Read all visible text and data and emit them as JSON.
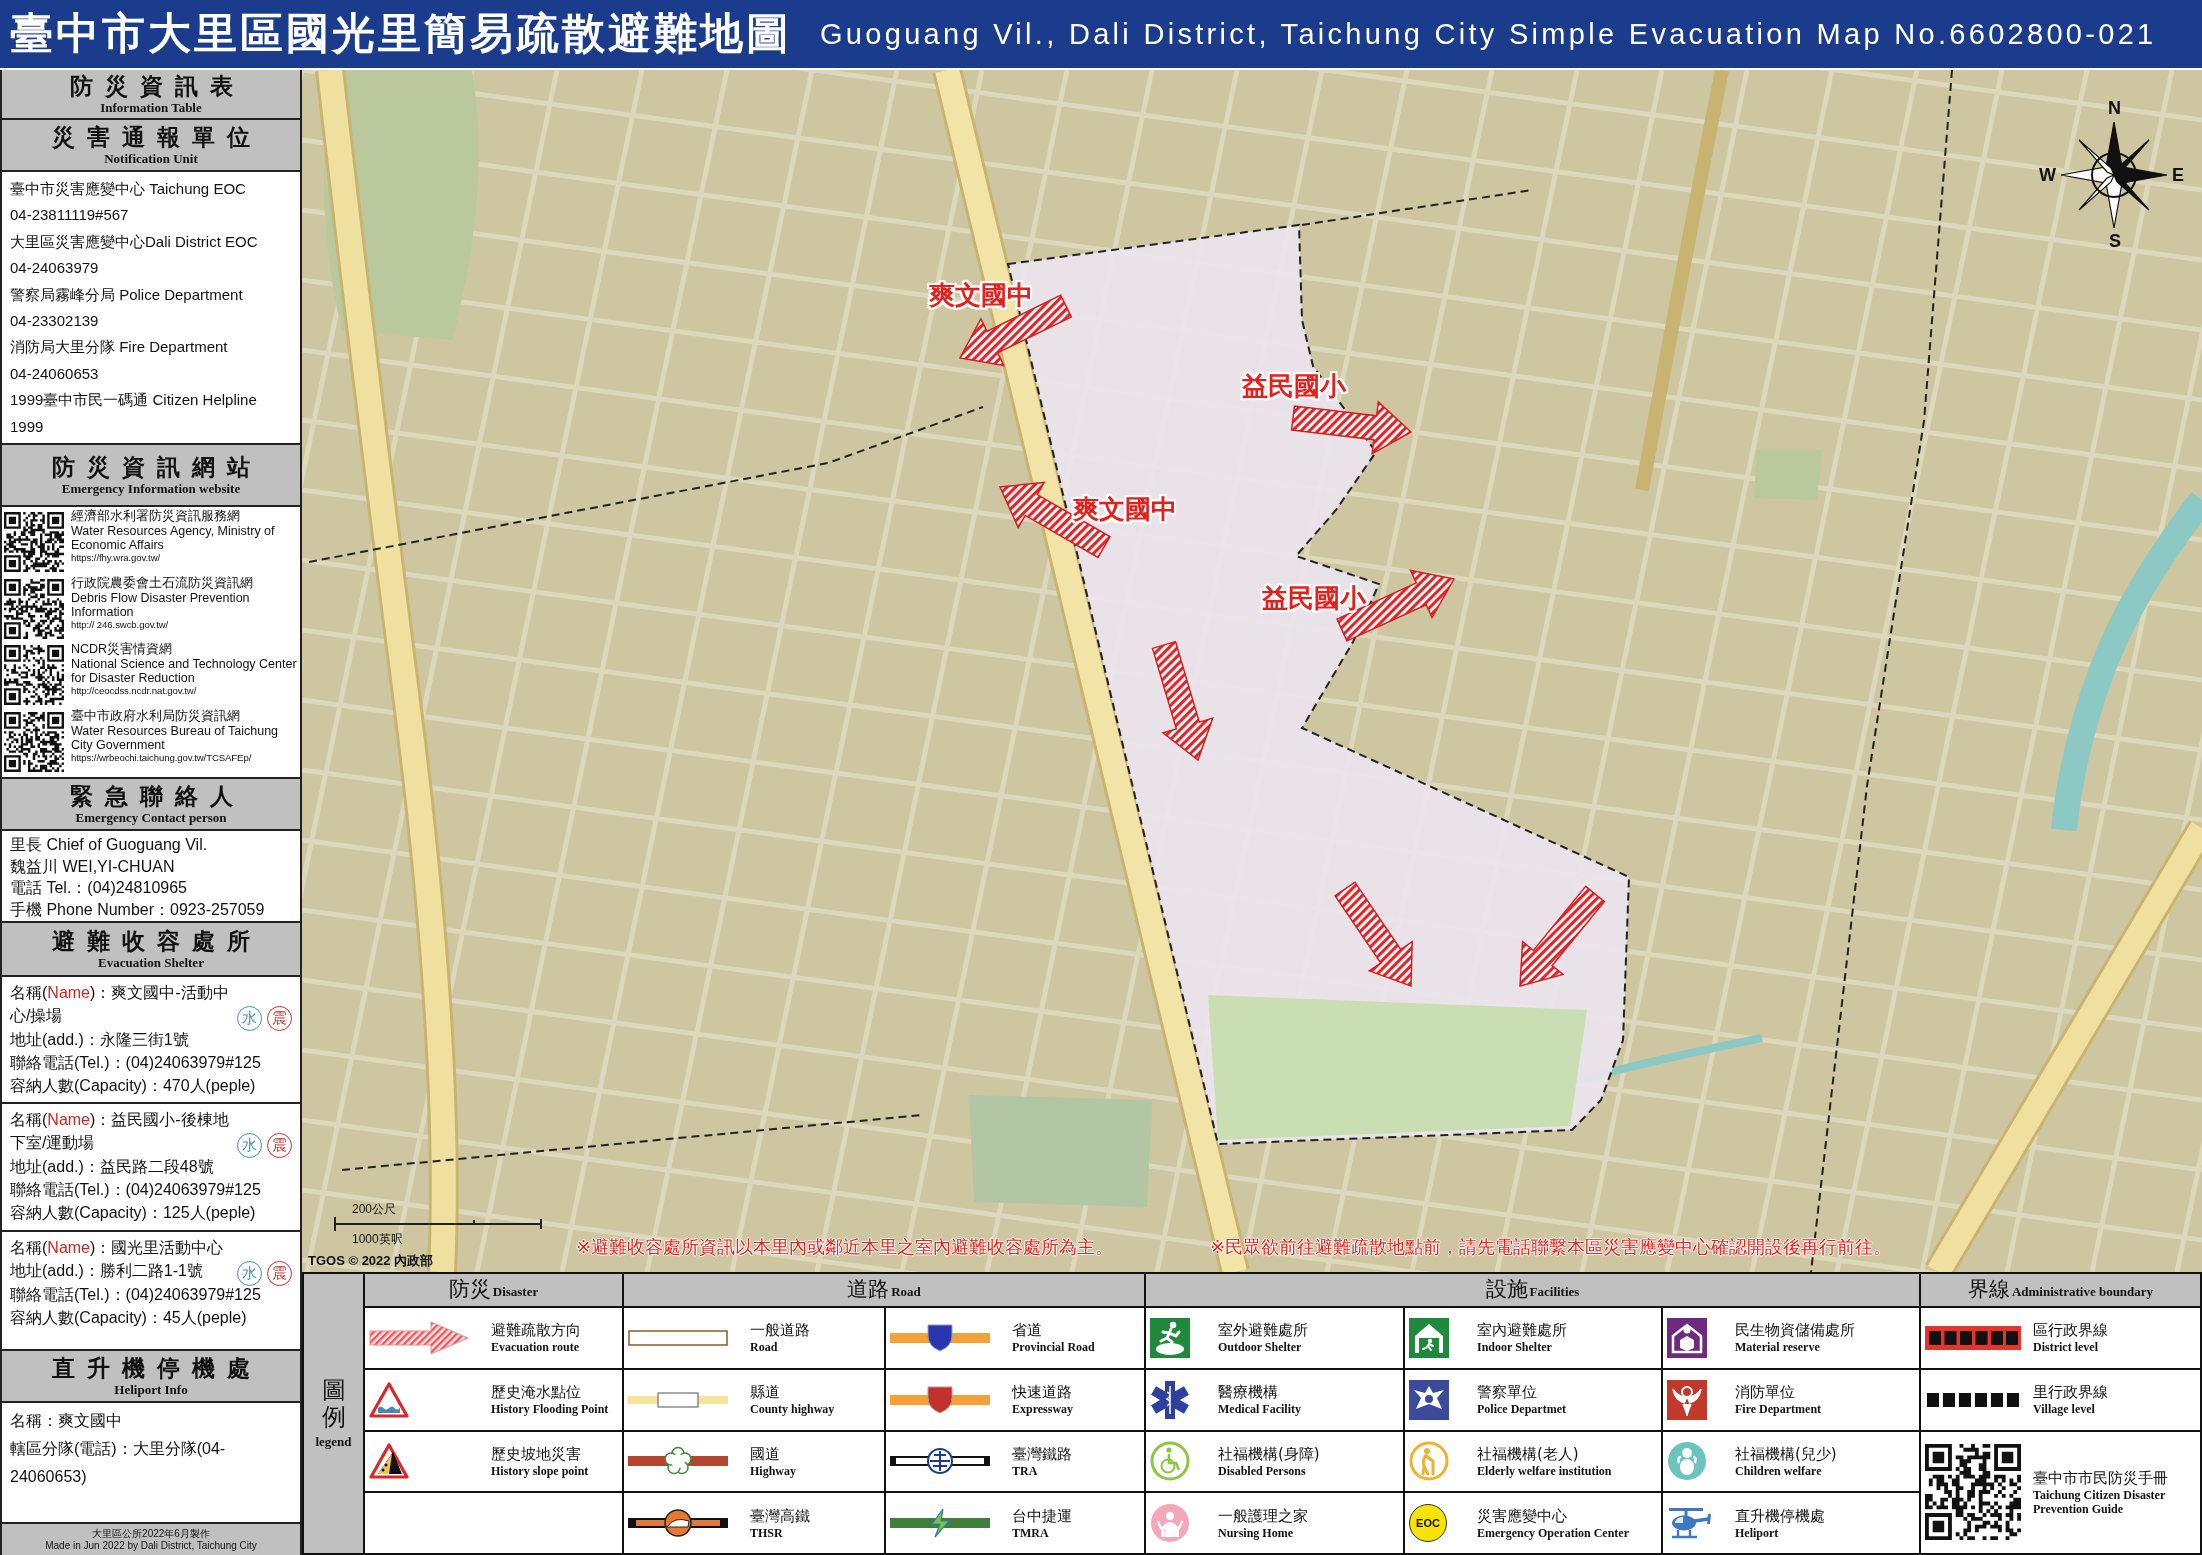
{
  "title": {
    "zh": "臺中市大里區國光里簡易疏散避難地圖",
    "en": "Guoguang Vil., Dali District, Taichung City Simple Evacuation Map No.6602800-021"
  },
  "sidebar": {
    "info_table": {
      "zh": "防災資訊表",
      "en": "Information Table"
    },
    "notification": {
      "header": {
        "zh": "災害通報單位",
        "en": "Notification Unit"
      },
      "units": [
        {
          "name": "臺中市災害應變中心 Taichung EOC",
          "phone": "04-23811119#567"
        },
        {
          "name": "大里區災害應變中心Dali District EOC",
          "phone": "04-24063979"
        },
        {
          "name": "警察局霧峰分局 Police Department",
          "phone": "04-23302139"
        },
        {
          "name": "消防局大里分隊 Fire Department",
          "phone": "04-24060653"
        },
        {
          "name": "1999臺中市民一碼通 Citizen Helpline",
          "phone": "1999"
        }
      ]
    },
    "websites": {
      "header": {
        "zh": "防災資訊網站",
        "en": "Emergency Information website"
      },
      "items": [
        {
          "zh": "經濟部水利署防災資訊服務網",
          "en": "Water Resources Agency, Ministry of Economic Affairs",
          "url": "https://fhy.wra.gov.tw/"
        },
        {
          "zh": "行政院農委會土石流防災資訊網",
          "en": "Debris Flow Disaster Prevention Information",
          "url": "http:// 246.swcb.gov.tw/"
        },
        {
          "zh": "NCDR災害情資網",
          "en": "National Science and Technology Center for Disaster Reduction",
          "url": "http://ceocdss.ncdr.nat.gov.tw/"
        },
        {
          "zh": "臺中市政府水利局防災資訊網",
          "en": "Water Resources Bureau of Taichung City Government",
          "url": "https://wrbeochi.taichung.gov.tw/TCSAFEp/"
        }
      ]
    },
    "contact": {
      "header": {
        "zh": "緊急聯絡人",
        "en": "Emergency Contact person"
      },
      "lines": [
        "里長 Chief of Guoguang Vil.",
        "魏益川 WEI,YI-CHUAN",
        "電話 Tel.：(04)24810965",
        "手機 Phone Number：0923-257059"
      ]
    },
    "shelters": {
      "header": {
        "zh": "避難收容處所",
        "en": "Evacuation Shelter"
      },
      "items": [
        {
          "name_label": [
            {
              "text": "名稱(",
              "accent": false
            },
            {
              "text": "Name",
              "accent": true
            },
            {
              "text": ")：",
              "accent": false
            }
          ],
          "name": "爽文國中-活動中心/操場",
          "lines": [
            "地址(add.)：永隆三街1號",
            "聯絡電話(Tel.)：(04)24063979#125",
            "容納人數(Capacity)：470人(peple)"
          ],
          "hazards": [
            {
              "label": "水",
              "color": "#3f95ad"
            },
            {
              "label": "震",
              "color": "#c8322c"
            }
          ]
        },
        {
          "name_label": [
            {
              "text": "名稱(",
              "accent": false
            },
            {
              "text": "Name",
              "accent": true
            },
            {
              "text": ")：",
              "accent": false
            }
          ],
          "name": "益民國小-後棟地下室/運動場",
          "lines": [
            "地址(add.)：益民路二段48號",
            "聯絡電話(Tel.)：(04)24063979#125",
            "容納人數(Capacity)：125人(peple)"
          ],
          "hazards": [
            {
              "label": "水",
              "color": "#3f95ad"
            },
            {
              "label": "震",
              "color": "#c8322c"
            }
          ]
        },
        {
          "name_label": [
            {
              "text": "名稱(",
              "accent": false
            },
            {
              "text": "Name",
              "accent": true
            },
            {
              "text": ")：",
              "accent": false
            }
          ],
          "name": "國光里活動中心",
          "lines": [
            "地址(add.)：勝利二路1-1號",
            "聯絡電話(Tel.)：(04)24063979#125",
            "容納人數(Capacity)：45人(peple)"
          ],
          "hazards": [
            {
              "label": "水",
              "color": "#3f95ad"
            },
            {
              "label": "震",
              "color": "#c8322c"
            }
          ]
        }
      ]
    },
    "heliport": {
      "header": {
        "zh": "直升機停機處",
        "en": "Heliport Info"
      },
      "lines": [
        "名稱：爽文國中",
        "轄區分隊(電話)：大里分隊(04-24060653)"
      ]
    },
    "footer": {
      "zh": "大里區公所2022年6月製作",
      "en": "Made in Jun 2022 by Dali District, Taichung City"
    }
  },
  "map": {
    "compass": {
      "n": "N",
      "e": "E",
      "s": "S",
      "w": "W"
    },
    "route_labels": [
      "爽文國中",
      "益民國小",
      "爽文國中",
      "益民國小"
    ],
    "scale": {
      "metric": "200公尺",
      "imperial": "1000英呎"
    },
    "copyright": "TGOS © 2022 內政部",
    "notices": [
      "※避難收容處所資訊以本里內或鄰近本里之室內避難收容處所為主。",
      "※民眾欲前往避難疏散地點前，請先電話聯繫本區災害應變中心確認開設後再行前往。"
    ]
  },
  "legend": {
    "title_zh": "圖例",
    "title_en": "legend",
    "groups": [
      {
        "zh": "防災",
        "en": "Disaster",
        "columns": [
          [
            {
              "kind": "route",
              "zh": "避難疏散方向",
              "en": "Evacuation route"
            },
            {
              "kind": "flood",
              "zh": "歷史淹水點位",
              "en": "History Flooding Point"
            },
            {
              "kind": "slope",
              "zh": "歷史坡地災害",
              "en": "History slope point"
            }
          ]
        ]
      },
      {
        "zh": "道路",
        "en": "Road",
        "columns": [
          [
            {
              "kind": "road",
              "zh": "一般道路",
              "en": "Road"
            },
            {
              "kind": "county",
              "zh": "縣道",
              "en": "County highway"
            },
            {
              "kind": "highway",
              "zh": "國道",
              "en": "Highway"
            },
            {
              "kind": "thsr",
              "zh": "臺灣高鐵",
              "en": "THSR"
            }
          ],
          [
            {
              "kind": "provincial",
              "zh": "省道",
              "en": "Provincial Road"
            },
            {
              "kind": "expressway",
              "zh": "快速道路",
              "en": "Expressway"
            },
            {
              "kind": "tra",
              "zh": "臺灣鐵路",
              "en": "TRA"
            },
            {
              "kind": "tmra",
              "zh": "台中捷運",
              "en": "TMRA"
            }
          ]
        ]
      },
      {
        "zh": "設施",
        "en": "Facilities",
        "columns": [
          [
            {
              "kind": "outdoor",
              "zh": "室外避難處所",
              "en": "Outdoor Shelter"
            },
            {
              "kind": "medical",
              "zh": "醫療機構",
              "en": "Medical Facility"
            },
            {
              "kind": "disabled",
              "zh": "社福機構(身障)",
              "en": "Disabled Persons"
            },
            {
              "kind": "nursing",
              "zh": "一般護理之家",
              "en": "Nursing Home"
            }
          ],
          [
            {
              "kind": "indoor",
              "zh": "室內避難處所",
              "en": "Indoor Shelter"
            },
            {
              "kind": "police",
              "zh": "警察單位",
              "en": "Police Departmet"
            },
            {
              "kind": "elderly",
              "zh": "社福機構(老人)",
              "en": "Elderly welfare institution"
            },
            {
              "kind": "eoc",
              "zh": "災害應變中心",
              "en": "Emergency Operation Center",
              "icon_text": "EOC"
            }
          ],
          [
            {
              "kind": "material",
              "zh": "民生物資儲備處所",
              "en": "Material reserve"
            },
            {
              "kind": "fire",
              "zh": "消防單位",
              "en": "Fire Department"
            },
            {
              "kind": "children",
              "zh": "社福機構(兒少)",
              "en": "Children welfare"
            },
            {
              "kind": "heliport",
              "zh": "直升機停機處",
              "en": "Heliport"
            }
          ]
        ]
      },
      {
        "zh": "界線",
        "en": "Administrative boundary",
        "columns": [
          [
            {
              "kind": "district",
              "zh": "區行政界線",
              "en": "District level"
            },
            {
              "kind": "village",
              "zh": "里行政界線",
              "en": "Village level"
            },
            {
              "kind": "guide",
              "zh": "臺中市市民防災手冊",
              "en": "Taichung Citizen Disaster Prevention Guide"
            }
          ]
        ]
      }
    ]
  }
}
